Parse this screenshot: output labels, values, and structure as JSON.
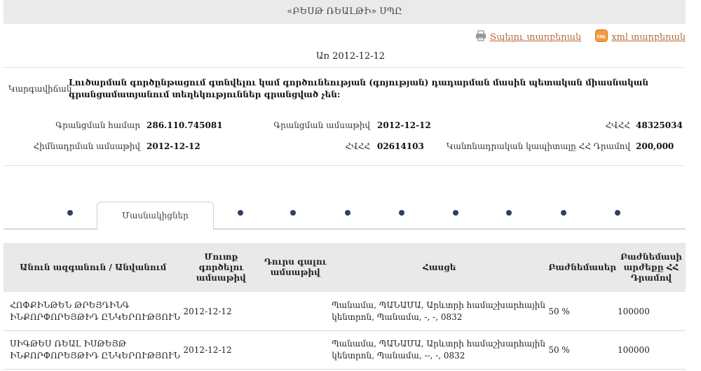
{
  "header": {
    "title": "«ԲԵՍԹ ՌԵԱԼԹԻ» ՍՊԸ"
  },
  "toolbar": {
    "print_label": "Տպելու տարբերակ",
    "xml_label": "xml տարբերակ",
    "xml_badge": "XML"
  },
  "date_line": "Առ 2012-12-12",
  "status": {
    "label": "Կարգավիճակ",
    "text": "Լուծարման գործընթացում գտնվելու կամ գործունեության (գոյության) դադարման մասին պետական միասնական գրանցամատյանում տեղեկություններ գրանցված չեն:"
  },
  "fields": {
    "reg_number": {
      "label": "Գրանցման համար",
      "value": "286.110.745081"
    },
    "reg_date": {
      "label": "Գրանցման ամսաթիվ",
      "value": "2012-12-12"
    },
    "tax_id": {
      "label": "ՀՎՀՀ",
      "value": "48325034"
    },
    "founding_date": {
      "label": "Հիմնադրման ամսաթիվ",
      "value": "2012-12-12"
    },
    "hvhh": {
      "label": "ՀՎՀՀ",
      "value": "02614103"
    },
    "capital": {
      "label": "Կանոնադրական կապիտալը ՀՀ Դրամով",
      "value": "200,000"
    }
  },
  "tabs": {
    "active_label": "Մասնակիցներ",
    "dots_count": 10
  },
  "table": {
    "headers": [
      "Անուն ազգանուն / Անվանում",
      "Մուտք գործելու ամսաթիվ",
      "Դուրս գալու ամսաթիվ",
      "Հասցե",
      "Բաժնեմասեր",
      "Բաժնեմասի արժեքը ՀՀ Դրամով"
    ],
    "rows": [
      [
        "ՀՈՓՔԻՆԹԵՆ ԹՐԵՅԴԻՆԳ ԻՆՔՈՐՓՈՐԵՅԹԻԴ ԸՆԿԵՐՈՒԹՅՈՒՆ",
        "2012-12-12",
        "",
        "Պանամա, ՊԱՆԱՄԱ, Արևտրի համաշխարհային կենտրոն, Պանամա, -, -, 0832",
        "50 %",
        "100000"
      ],
      [
        "ՍԻԳԹԵՍ ՌԵԱԼ ԻՍԹԵՅԹ ԻՆՔՈՐՓՈՐԵՅԹԻԴ ԸՆԿԵՐՈՒԹՅՈՒՆ",
        "2012-12-12",
        "",
        "Պանամա, ՊԱՆԱՄԱ, Արևտրի համաշխարհային կենտրոն, Պանամա, --, -, 0832",
        "50 %",
        "100000"
      ]
    ]
  },
  "colors": {
    "link": "#b66a3a",
    "tab_dot": "#2c3f66",
    "header_bg": "#e9e9e9"
  }
}
